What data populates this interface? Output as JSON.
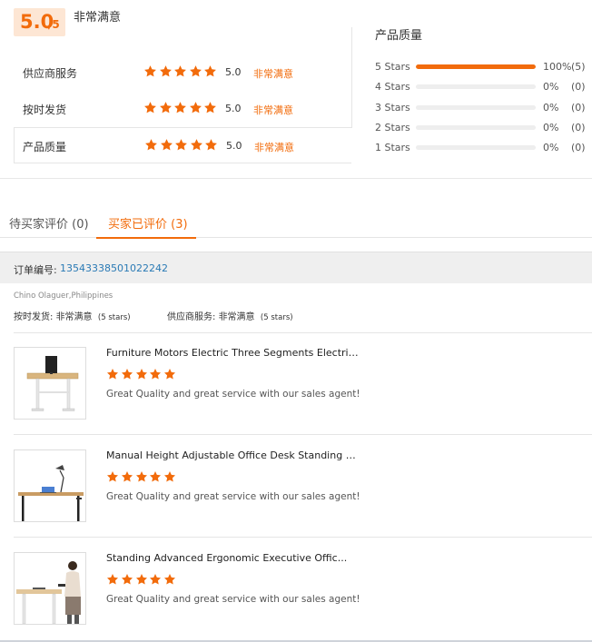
{
  "summary": {
    "score": "5.0",
    "score_max": "/5",
    "overall_label": "非常满意",
    "ratings": [
      {
        "label": "供应商服务",
        "value": "5.0",
        "text": "非常满意",
        "stars": 5
      },
      {
        "label": "按时发货",
        "value": "5.0",
        "text": "非常满意",
        "stars": 5
      },
      {
        "label": "产品质量",
        "value": "5.0",
        "text": "非常满意",
        "stars": 5
      }
    ]
  },
  "quality": {
    "title": "产品质量",
    "distribution": [
      {
        "label": "5  Stars",
        "fill_percent": 100,
        "pct": "100%",
        "count": "(5)"
      },
      {
        "label": "4  Stars",
        "fill_percent": 0,
        "pct": "0%",
        "count": "(0)"
      },
      {
        "label": "3  Stars",
        "fill_percent": 0,
        "pct": "0%",
        "count": "(0)"
      },
      {
        "label": "2  Stars",
        "fill_percent": 0,
        "pct": "0%",
        "count": "(0)"
      },
      {
        "label": "1  Stars",
        "fill_percent": 0,
        "pct": "0%",
        "count": "(0)"
      }
    ]
  },
  "tabs": [
    {
      "label": "待买家评价 (0)",
      "active": false
    },
    {
      "label": "买家已评价 (3)",
      "active": true
    }
  ],
  "order": {
    "label": "订单编号:",
    "number": "13543338501022242"
  },
  "review": {
    "buyer": "Chino Olaguer,Philippines",
    "delivery_label": "按时发货:",
    "delivery_value": "非常满意",
    "delivery_stars": "(5 stars)",
    "service_label": "供应商服务:",
    "service_value": "非常满意",
    "service_stars": "(5 stars)"
  },
  "products": [
    {
      "title": "Furniture Motors Electric Three Segments Electric Adj...",
      "stars": 5,
      "comment": "Great Quality and great service with our sales agent!"
    },
    {
      "title": "Manual Height Adjustable Office Desk Standing Desk ...",
      "stars": 5,
      "comment": "Great Quality and great service with our sales agent!"
    },
    {
      "title": "Standing Advanced Ergonomic Executive Offic...",
      "stars": 5,
      "comment": "Great Quality and great service with our sales agent!"
    }
  ],
  "colors": {
    "accent": "#f26b0b",
    "score_bg": "#fde6d4",
    "link": "#2a7ab5"
  }
}
